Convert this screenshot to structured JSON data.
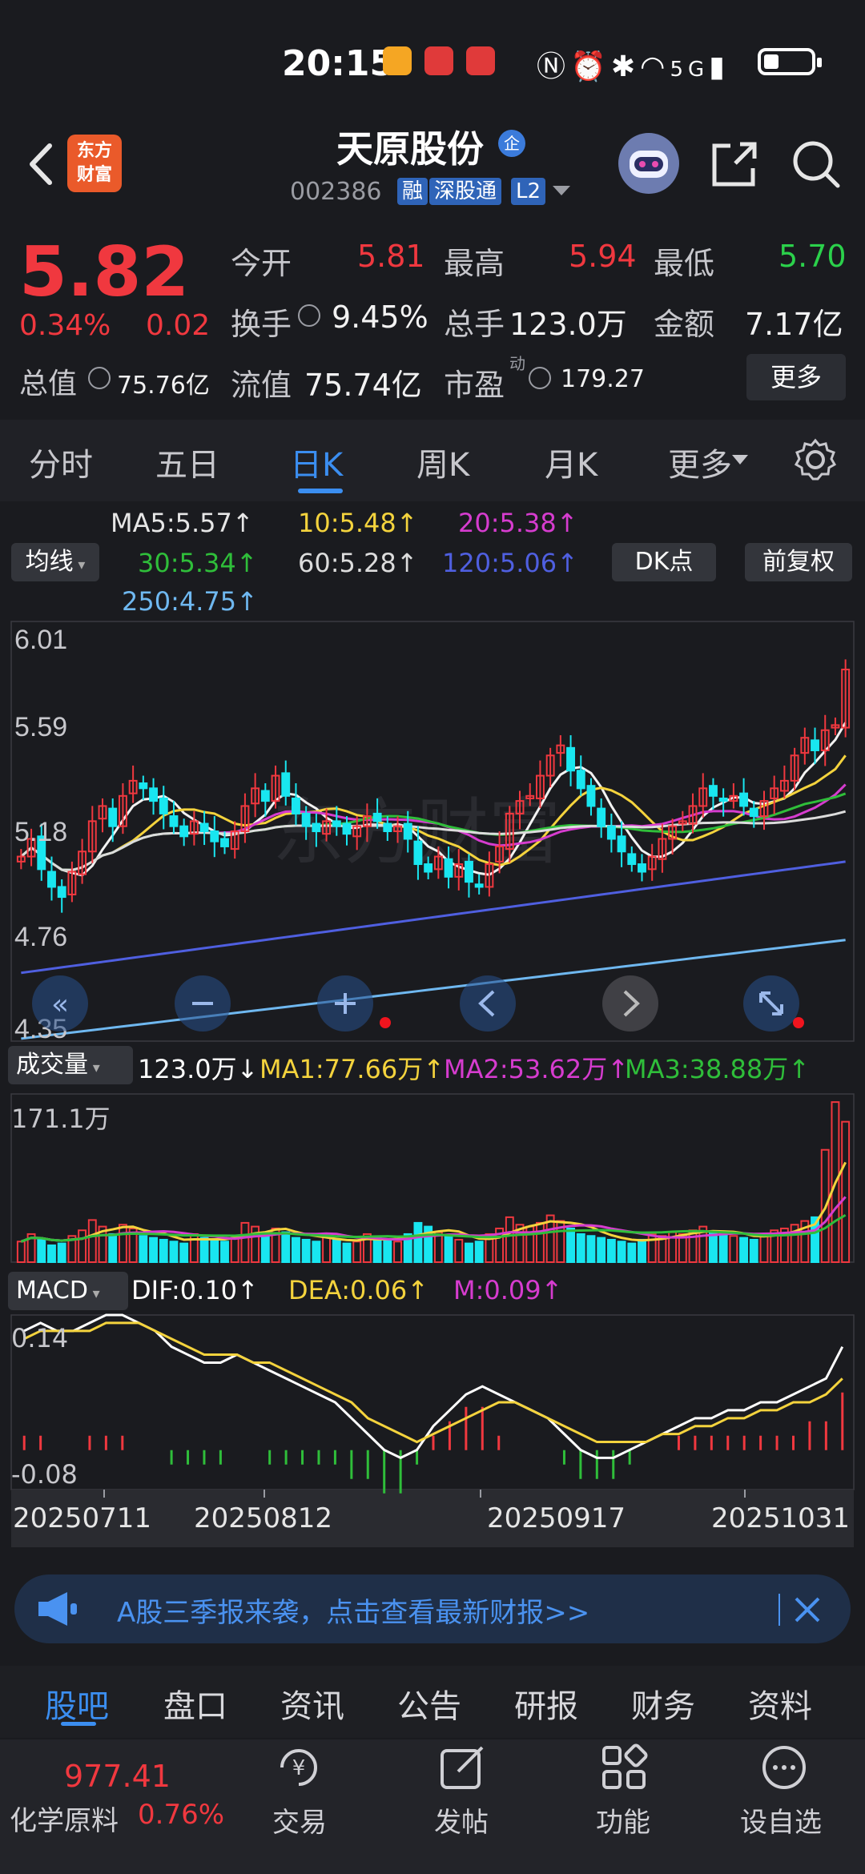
{
  "status": {
    "time": "20:15",
    "network": "5G"
  },
  "header": {
    "stock_name": "天原股份",
    "stock_code": "002386",
    "logo_text": "东方财富",
    "badge": "企",
    "tags": [
      "融",
      "深股通",
      "L2"
    ]
  },
  "quote": {
    "price": "5.82",
    "pct": "0.34%",
    "change": "0.02",
    "rows": [
      [
        {
          "label": "今开",
          "value": "5.81",
          "color": "red"
        },
        {
          "label": "最高",
          "value": "5.94",
          "color": "red"
        },
        {
          "label": "最低",
          "value": "5.70",
          "color": "green"
        }
      ],
      [
        {
          "label": "换手",
          "value": "9.45%",
          "color": "white"
        },
        {
          "label": "总手",
          "value": "123.0万",
          "color": "white"
        },
        {
          "label": "金额",
          "value": "7.17亿",
          "color": "white"
        }
      ]
    ],
    "total_value_label": "总值",
    "total_value": "75.76亿",
    "float_value_label": "流值",
    "float_value": "75.74亿",
    "pe_label": "市盈",
    "pe_super": "动",
    "pe_value": "179.27",
    "more_label": "更多"
  },
  "tabs": [
    "分时",
    "五日",
    "日K",
    "周K",
    "月K",
    "更多"
  ],
  "ma_legend": {
    "selector": "均线",
    "items": [
      {
        "text": "MA5:5.57↑",
        "color": "#f2f2f2"
      },
      {
        "text": "10:5.48↑",
        "color": "#f4d33d"
      },
      {
        "text": "20:5.38↑",
        "color": "#d63ccf"
      },
      {
        "text": "30:5.34↑",
        "color": "#2fbe3a"
      },
      {
        "text": "60:5.28↑",
        "color": "#dcdcdc"
      },
      {
        "text": "120:5.06↑",
        "color": "#4f5fe0"
      },
      {
        "text": "250:4.75↑",
        "color": "#6fb8f0"
      }
    ],
    "dk_label": "DK点",
    "fq_label": "前复权"
  },
  "price_axis": [
    "6.01",
    "5.59",
    "5.18",
    "4.76",
    "4.35"
  ],
  "volume_legend": {
    "selector": "成交量",
    "vol": "123.0万↓",
    "ma1": "MA1:77.66万↑",
    "ma2": "MA2:53.62万↑",
    "ma3": "MA3:38.88万↑",
    "max_label": "171.1万"
  },
  "macd_legend": {
    "selector": "MACD",
    "dif": "DIF:0.10↑",
    "dea": "DEA:0.06↑",
    "m": "M:0.09↑",
    "top": "0.14",
    "bottom": "-0.08"
  },
  "date_axis": [
    "20250711",
    "20250812",
    "20250917",
    "20251031"
  ],
  "colors": {
    "up": "#f0383f",
    "down": "#19e6f0",
    "accent": "#3b8ef0"
  },
  "chart_data": {
    "type": "candlestick",
    "ylim": [
      4.35,
      6.01
    ],
    "x_labels": [
      "20250711",
      "20250812",
      "20250917",
      "20251031"
    ],
    "close": [
      5.08,
      5.15,
      5.03,
      4.96,
      4.92,
      5.02,
      5.1,
      5.22,
      5.28,
      5.2,
      5.32,
      5.38,
      5.35,
      5.3,
      5.25,
      5.2,
      5.16,
      5.22,
      5.18,
      5.14,
      5.12,
      5.18,
      5.28,
      5.35,
      5.3,
      5.4,
      5.32,
      5.25,
      5.2,
      5.18,
      5.22,
      5.2,
      5.17,
      5.2,
      5.24,
      5.22,
      5.18,
      5.2,
      5.15,
      5.05,
      5.02,
      5.08,
      5.0,
      5.05,
      4.98,
      4.96,
      5.05,
      5.12,
      5.25,
      5.3,
      5.32,
      5.4,
      5.48,
      5.52,
      5.42,
      5.35,
      5.28,
      5.2,
      5.15,
      5.1,
      5.05,
      5.02,
      5.08,
      5.15,
      5.2,
      5.22,
      5.28,
      5.35,
      5.32,
      5.3,
      5.32,
      5.28,
      5.24,
      5.3,
      5.35,
      5.38,
      5.48,
      5.55,
      5.5,
      5.58,
      5.6,
      5.82
    ],
    "volume_max": 171.1,
    "volume": [
      22,
      30,
      25,
      18,
      20,
      28,
      34,
      45,
      38,
      30,
      40,
      36,
      28,
      26,
      24,
      22,
      20,
      30,
      26,
      24,
      22,
      28,
      42,
      38,
      30,
      36,
      32,
      26,
      24,
      22,
      28,
      24,
      20,
      22,
      30,
      26,
      24,
      22,
      30,
      42,
      38,
      32,
      28,
      24,
      20,
      22,
      30,
      36,
      48,
      40,
      38,
      42,
      50,
      44,
      36,
      30,
      28,
      26,
      24,
      22,
      20,
      24,
      30,
      28,
      32,
      30,
      34,
      38,
      32,
      30,
      28,
      26,
      24,
      30,
      34,
      36,
      40,
      44,
      48,
      120,
      171,
      150
    ],
    "macd_range": [
      -0.08,
      0.14
    ],
    "dif": [
      0.12,
      0.13,
      0.12,
      0.12,
      0.13,
      0.14,
      0.14,
      0.13,
      0.12,
      0.1,
      0.09,
      0.08,
      0.08,
      0.09,
      0.08,
      0.07,
      0.06,
      0.05,
      0.04,
      0.03,
      0.01,
      -0.01,
      -0.03,
      -0.04,
      -0.03,
      0.0,
      0.02,
      0.04,
      0.05,
      0.04,
      0.03,
      0.02,
      0.01,
      -0.01,
      -0.03,
      -0.04,
      -0.04,
      -0.03,
      -0.02,
      -0.01,
      0.0,
      0.01,
      0.01,
      0.02,
      0.02,
      0.03,
      0.03,
      0.04,
      0.05,
      0.06,
      0.1
    ],
    "dea": [
      0.11,
      0.12,
      0.12,
      0.12,
      0.12,
      0.13,
      0.13,
      0.13,
      0.12,
      0.11,
      0.1,
      0.09,
      0.09,
      0.09,
      0.08,
      0.08,
      0.07,
      0.06,
      0.05,
      0.04,
      0.03,
      0.01,
      0.0,
      -0.01,
      -0.02,
      -0.01,
      0.0,
      0.01,
      0.02,
      0.03,
      0.03,
      0.02,
      0.01,
      0.0,
      -0.01,
      -0.02,
      -0.02,
      -0.02,
      -0.02,
      -0.01,
      -0.01,
      0.0,
      0.0,
      0.01,
      0.01,
      0.02,
      0.02,
      0.03,
      0.03,
      0.04,
      0.06
    ]
  },
  "banner": {
    "text": "A股三季报来袭，点击查看最新财报>>"
  },
  "info_tabs": [
    "股吧",
    "盘口",
    "资讯",
    "公告",
    "研报",
    "财务",
    "资料"
  ],
  "bottom_nav": {
    "index_value": "977.41",
    "index_name": "化学原料",
    "index_pct": "0.76%",
    "items": [
      "交易",
      "发帖",
      "功能",
      "设自选"
    ]
  }
}
